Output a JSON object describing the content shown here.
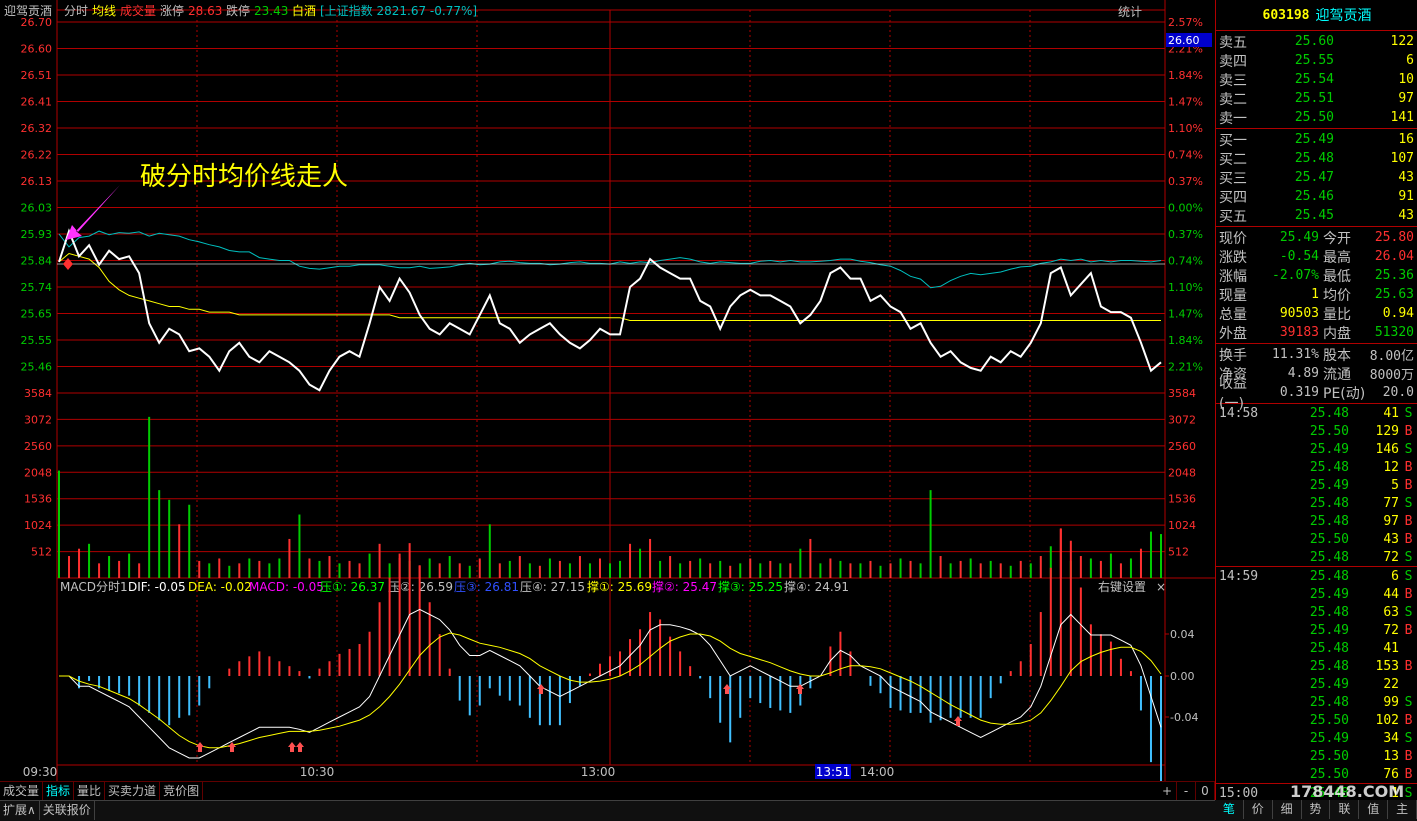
{
  "chart_header": {
    "stock_name": "迎驾贡酒",
    "mode": "分时",
    "avg_label": "均线",
    "vol_label": "成交量",
    "limit_up_label": "涨停",
    "limit_up_value": "28.63",
    "limit_down_label": "跌停",
    "limit_down_value": "23.43",
    "sector": "白酒",
    "index_info": "[上证指数 2821.67 -0.77%]",
    "stats_label": "统计"
  },
  "annotation": "破分时均价线走人",
  "price_axis": {
    "left": [
      "26.70",
      "26.60",
      "26.51",
      "26.41",
      "26.32",
      "26.22",
      "26.13",
      "26.03",
      "25.93",
      "25.84",
      "25.74",
      "25.65",
      "25.55",
      "25.46"
    ],
    "right": [
      "2.57%",
      "2.21%",
      "1.84%",
      "1.47%",
      "1.10%",
      "0.74%",
      "0.37%",
      "0.00%",
      "0.37%",
      "0.74%",
      "1.10%",
      "1.47%",
      "1.84%",
      "2.21%"
    ],
    "tag": "26.60"
  },
  "volume_axis": [
    "3584",
    "3072",
    "2560",
    "2048",
    "1536",
    "1024",
    "512"
  ],
  "macd_header": {
    "name": "MACD分时1",
    "dif": "DIF: -0.05",
    "dea": "DEA: -0.02",
    "macd": "MACD: -0.05",
    "p1": "压①: 26.37",
    "p2": "压②: 26.59",
    "p3": "压③: 26.81",
    "p4": "压④: 27.15",
    "s1": "撑①: 25.69",
    "s2": "撑②: 25.47",
    "s3": "撑③: 25.25",
    "s4": "撑④: 24.91",
    "settings": "右键设置"
  },
  "macd_axis": [
    "0.04",
    "0.00",
    "-0.04"
  ],
  "time_axis": [
    "09:30",
    "10:30",
    "13:00",
    "14:00"
  ],
  "cursor_time": "13:51",
  "bottom_tabs": [
    "成交量",
    "指标",
    "量比",
    "买卖力道",
    "竞价图"
  ],
  "bottom_bar": [
    "扩展∧",
    "关联报价"
  ],
  "panel": {
    "code": "603198",
    "name": "迎驾贡酒",
    "asks": [
      {
        "label": "卖五",
        "price": "25.60",
        "vol": "122"
      },
      {
        "label": "卖四",
        "price": "25.55",
        "vol": "6"
      },
      {
        "label": "卖三",
        "price": "25.54",
        "vol": "10"
      },
      {
        "label": "卖二",
        "price": "25.51",
        "vol": "97"
      },
      {
        "label": "卖一",
        "price": "25.50",
        "vol": "141"
      }
    ],
    "bids": [
      {
        "label": "买一",
        "price": "25.49",
        "vol": "16"
      },
      {
        "label": "买二",
        "price": "25.48",
        "vol": "107"
      },
      {
        "label": "买三",
        "price": "25.47",
        "vol": "43"
      },
      {
        "label": "买四",
        "price": "25.46",
        "vol": "91"
      },
      {
        "label": "买五",
        "price": "25.45",
        "vol": "43"
      }
    ],
    "stats1": [
      {
        "k1": "现价",
        "v1": "25.49",
        "k2": "今开",
        "v2": "25.80",
        "c1": "#00cc00",
        "c2": "#ff3030"
      },
      {
        "k1": "涨跌",
        "v1": "-0.54",
        "k2": "最高",
        "v2": "26.04",
        "c1": "#00cc00",
        "c2": "#ff3030"
      },
      {
        "k1": "涨幅",
        "v1": "-2.07%",
        "k2": "最低",
        "v2": "25.36",
        "c1": "#00cc00",
        "c2": "#00cc00"
      },
      {
        "k1": "现量",
        "v1": "1",
        "k2": "均价",
        "v2": "25.63",
        "c1": "#ffff00",
        "c2": "#00cc00"
      },
      {
        "k1": "总量",
        "v1": "90503",
        "k2": "量比",
        "v2": "0.94",
        "c1": "#ffff00",
        "c2": "#ffff00"
      },
      {
        "k1": "外盘",
        "v1": "39183",
        "k2": "内盘",
        "v2": "51320",
        "c1": "#ff3030",
        "c2": "#00cc00"
      }
    ],
    "stats2": [
      {
        "k1": "换手",
        "v1": "11.31%",
        "k2": "股本",
        "v2": "8.00亿"
      },
      {
        "k1": "净资",
        "v1": "4.89",
        "k2": "流通",
        "v2": "8000万"
      },
      {
        "k1": "收益(一)",
        "v1": "0.319",
        "k2": "PE(动)",
        "v2": "20.0"
      }
    ],
    "ticks": [
      {
        "t": "14:58",
        "p": "25.48",
        "v": "41",
        "d": "S"
      },
      {
        "t": "",
        "p": "25.50",
        "v": "129",
        "d": "B"
      },
      {
        "t": "",
        "p": "25.49",
        "v": "146",
        "d": "S"
      },
      {
        "t": "",
        "p": "25.48",
        "v": "12",
        "d": "B"
      },
      {
        "t": "",
        "p": "25.49",
        "v": "5",
        "d": "B"
      },
      {
        "t": "",
        "p": "25.48",
        "v": "77",
        "d": "S"
      },
      {
        "t": "",
        "p": "25.48",
        "v": "97",
        "d": "B"
      },
      {
        "t": "",
        "p": "25.50",
        "v": "43",
        "d": "B"
      },
      {
        "t": "",
        "p": "25.48",
        "v": "72",
        "d": "S"
      },
      {
        "t": "14:59",
        "p": "25.48",
        "v": "6",
        "d": "S"
      },
      {
        "t": "",
        "p": "25.49",
        "v": "44",
        "d": "B"
      },
      {
        "t": "",
        "p": "25.48",
        "v": "63",
        "d": "S"
      },
      {
        "t": "",
        "p": "25.49",
        "v": "72",
        "d": "B"
      },
      {
        "t": "",
        "p": "25.48",
        "v": "41",
        "d": ""
      },
      {
        "t": "",
        "p": "25.48",
        "v": "153",
        "d": "B"
      },
      {
        "t": "",
        "p": "25.49",
        "v": "22",
        "d": ""
      },
      {
        "t": "",
        "p": "25.48",
        "v": "99",
        "d": "S"
      },
      {
        "t": "",
        "p": "25.50",
        "v": "102",
        "d": "B"
      },
      {
        "t": "",
        "p": "25.49",
        "v": "34",
        "d": "S"
      },
      {
        "t": "",
        "p": "25.50",
        "v": "13",
        "d": "B"
      },
      {
        "t": "",
        "p": "25.50",
        "v": "76",
        "d": "B"
      },
      {
        "t": "15:00",
        "p": "25.48",
        "v": "1",
        "d": "S"
      }
    ],
    "tabs": [
      "笔",
      "价",
      "细",
      "势",
      "联",
      "值",
      "主"
    ]
  },
  "watermark": "178448.COM",
  "colors": {
    "up": "#ff3030",
    "down": "#00cc00",
    "grid": "#b00000",
    "price_line": "#ffffff",
    "avg_line": "#ffff00",
    "index_line": "#00bfbf"
  },
  "chart_data": {
    "type": "line",
    "price_series": [
      25.84,
      25.95,
      25.86,
      25.9,
      25.83,
      25.88,
      25.85,
      25.86,
      25.8,
      25.62,
      25.55,
      25.6,
      25.58,
      25.52,
      25.53,
      25.5,
      25.45,
      25.52,
      25.55,
      25.5,
      25.48,
      25.52,
      25.5,
      25.48,
      25.45,
      25.4,
      25.38,
      25.45,
      25.5,
      25.52,
      25.5,
      25.62,
      25.75,
      25.7,
      25.78,
      25.73,
      25.65,
      25.6,
      25.58,
      25.62,
      25.6,
      25.58,
      25.65,
      25.72,
      25.62,
      25.6,
      25.55,
      25.58,
      25.6,
      25.62,
      25.58,
      25.55,
      25.53,
      25.56,
      25.6,
      25.58,
      25.58,
      25.75,
      25.78,
      25.85,
      25.82,
      25.8,
      25.78,
      25.78,
      25.7,
      25.68,
      25.6,
      25.68,
      25.72,
      25.74,
      25.72,
      25.72,
      25.7,
      25.68,
      25.62,
      25.65,
      25.7,
      25.8,
      25.82,
      25.78,
      25.78,
      25.7,
      25.72,
      25.68,
      25.66,
      25.6,
      25.62,
      25.55,
      25.5,
      25.52,
      25.48,
      25.46,
      25.45,
      25.5,
      25.48,
      25.52,
      25.5,
      25.55,
      25.62,
      25.8,
      25.82,
      25.72,
      25.76,
      25.8,
      25.68,
      25.66,
      25.66,
      25.64,
      25.55,
      25.45,
      25.48
    ],
    "avg_series": [
      25.84,
      25.87,
      25.86,
      25.85,
      25.82,
      25.77,
      25.74,
      25.72,
      25.71,
      25.7,
      25.69,
      25.68,
      25.68,
      25.67,
      25.67,
      25.66,
      25.66,
      25.66,
      25.65,
      25.65,
      25.65,
      25.65,
      25.65,
      25.65,
      25.65,
      25.65,
      25.65,
      25.65,
      25.65,
      25.65,
      25.65,
      25.65,
      25.65,
      25.65,
      25.64,
      25.64,
      25.64,
      25.64,
      25.64,
      25.64,
      25.64,
      25.64,
      25.64,
      25.64,
      25.64,
      25.64,
      25.64,
      25.64,
      25.64,
      25.64,
      25.64,
      25.64,
      25.64,
      25.64,
      25.64,
      25.64,
      25.64,
      25.63,
      25.63,
      25.63,
      25.63,
      25.63,
      25.63,
      25.63,
      25.63,
      25.63,
      25.63,
      25.63,
      25.63,
      25.63,
      25.63,
      25.63,
      25.63,
      25.63,
      25.63,
      25.63,
      25.63,
      25.63,
      25.63,
      25.63,
      25.63,
      25.63,
      25.63,
      25.63,
      25.63,
      25.63,
      25.63,
      25.63,
      25.63,
      25.63,
      25.63,
      25.63,
      25.63,
      25.63,
      25.63,
      25.63,
      25.63,
      25.63,
      25.63,
      25.63,
      25.63,
      25.63,
      25.63,
      25.63,
      25.63,
      25.63,
      25.63,
      25.63,
      25.63,
      25.63,
      25.63
    ],
    "index_series_pct": [
      0.37,
      0.55,
      0.42,
      0.4,
      0.33,
      0.38,
      0.35,
      0.36,
      0.34,
      0.4,
      0.36,
      0.38,
      0.4,
      0.45,
      0.48,
      0.52,
      0.55,
      0.6,
      0.62,
      0.62,
      0.7,
      0.72,
      0.74,
      0.74,
      0.82,
      0.85,
      0.86,
      0.84,
      0.82,
      0.82,
      0.8,
      0.8,
      0.8,
      0.82,
      0.84,
      0.84,
      0.82,
      0.85,
      0.84,
      0.83,
      0.8,
      0.78,
      0.8,
      0.79,
      0.76,
      0.75,
      0.77,
      0.78,
      0.78,
      0.8,
      0.79,
      0.77,
      0.76,
      0.78,
      0.78,
      0.79,
      0.76,
      0.78,
      0.76,
      0.77,
      0.74,
      0.72,
      0.7,
      0.72,
      0.76,
      0.78,
      0.76,
      0.77,
      0.78,
      0.78,
      0.75,
      0.74,
      0.76,
      0.74,
      0.76,
      0.76,
      0.75,
      0.74,
      0.72,
      0.72,
      0.75,
      0.77,
      0.8,
      0.82,
      0.88,
      0.96,
      1.0,
      1.12,
      1.1,
      1.02,
      0.96,
      0.92,
      0.94,
      0.92,
      0.9,
      0.86,
      0.83,
      0.82,
      0.78,
      0.76,
      0.72,
      0.74,
      0.72,
      0.76,
      0.74,
      0.76,
      0.74,
      0.74,
      0.75,
      0.76,
      0.74
    ],
    "volume": [
      2200,
      450,
      600,
      700,
      300,
      450,
      350,
      500,
      300,
      3300,
      1800,
      1600,
      1100,
      1500,
      350,
      300,
      400,
      250,
      300,
      400,
      350,
      300,
      400,
      800,
      1300,
      400,
      350,
      450,
      300,
      350,
      300,
      500,
      700,
      300,
      500,
      350,
      250,
      400,
      300,
      450,
      300,
      250,
      400,
      1100,
      300,
      350,
      450,
      300,
      250,
      400,
      350,
      300,
      450,
      300,
      400,
      300,
      350,
      700,
      600,
      800,
      350,
      450,
      300,
      350,
      400,
      300,
      350,
      250,
      300,
      400,
      300,
      350,
      300,
      300,
      600,
      800,
      300,
      400,
      350,
      300,
      300,
      350,
      250,
      300,
      400,
      350,
      300,
      1800,
      450,
      300,
      350,
      400,
      300,
      350,
      300,
      250,
      350,
      300,
      450,
      650,
      1000,
      350,
      450,
      400,
      350,
      500,
      300,
      400,
      600,
      950,
      900
    ],
    "volume_up": [
      false,
      true,
      true,
      false,
      true,
      false,
      true,
      false,
      true,
      false,
      false,
      false,
      true,
      false,
      true,
      false,
      true,
      false,
      true,
      false,
      true,
      false,
      false,
      true,
      false,
      true,
      false,
      true,
      false,
      true,
      true,
      false,
      true,
      false,
      true,
      false,
      true,
      false,
      true,
      false,
      true,
      false,
      true,
      false,
      true,
      false,
      true,
      false,
      true,
      false,
      true,
      false,
      true,
      false,
      true,
      false,
      false,
      true,
      false,
      true,
      false,
      true,
      false,
      true,
      false,
      true,
      false,
      true,
      false,
      true,
      false,
      true,
      false,
      true,
      false,
      true,
      false,
      true,
      false,
      true,
      false,
      true,
      false,
      true,
      false,
      true,
      false,
      false,
      true,
      false,
      true,
      false,
      true,
      false,
      true,
      false,
      true,
      false,
      true,
      false,
      true,
      false,
      true,
      false,
      true,
      false,
      true,
      false,
      true,
      false,
      false
    ],
    "macd_dif": [
      0.0,
      0.0,
      -0.01,
      -0.01,
      -0.015,
      -0.02,
      -0.025,
      -0.03,
      -0.04,
      -0.05,
      -0.06,
      -0.07,
      -0.075,
      -0.08,
      -0.08,
      -0.075,
      -0.07,
      -0.065,
      -0.06,
      -0.055,
      -0.05,
      -0.05,
      -0.05,
      -0.05,
      -0.052,
      -0.055,
      -0.05,
      -0.045,
      -0.04,
      -0.035,
      -0.03,
      -0.02,
      0.0,
      0.02,
      0.04,
      0.06,
      0.065,
      0.06,
      0.055,
      0.045,
      0.03,
      0.02,
      0.02,
      0.025,
      0.02,
      0.015,
      0.01,
      0.0,
      -0.01,
      -0.015,
      -0.02,
      -0.015,
      -0.01,
      -0.005,
      0.0,
      0.005,
      0.01,
      0.02,
      0.03,
      0.045,
      0.05,
      0.05,
      0.048,
      0.045,
      0.04,
      0.03,
      0.015,
      0.0,
      0.005,
      0.01,
      0.005,
      0.0,
      -0.005,
      -0.01,
      -0.01,
      -0.005,
      0.0,
      0.015,
      0.025,
      0.02,
      0.01,
      0.005,
      0.0,
      -0.01,
      -0.015,
      -0.02,
      -0.025,
      -0.035,
      -0.04,
      -0.045,
      -0.05,
      -0.055,
      -0.06,
      -0.055,
      -0.05,
      -0.045,
      -0.04,
      -0.03,
      -0.01,
      0.02,
      0.05,
      0.06,
      0.05,
      0.04,
      0.04,
      0.04,
      0.035,
      0.03,
      0.01,
      -0.02,
      -0.05
    ],
    "macd_dea": [
      0.0,
      0.0,
      -0.005,
      -0.008,
      -0.01,
      -0.014,
      -0.018,
      -0.022,
      -0.028,
      -0.035,
      -0.042,
      -0.05,
      -0.058,
      -0.064,
      -0.068,
      -0.07,
      -0.07,
      -0.068,
      -0.066,
      -0.063,
      -0.06,
      -0.058,
      -0.056,
      -0.054,
      -0.054,
      -0.054,
      -0.053,
      -0.051,
      -0.049,
      -0.046,
      -0.043,
      -0.038,
      -0.03,
      -0.02,
      -0.008,
      0.006,
      0.02,
      0.03,
      0.038,
      0.042,
      0.04,
      0.036,
      0.032,
      0.03,
      0.028,
      0.025,
      0.022,
      0.017,
      0.01,
      0.005,
      0.0,
      -0.004,
      -0.006,
      -0.006,
      -0.005,
      -0.003,
      0.0,
      0.005,
      0.011,
      0.019,
      0.027,
      0.034,
      0.038,
      0.041,
      0.041,
      0.039,
      0.034,
      0.027,
      0.022,
      0.019,
      0.016,
      0.013,
      0.009,
      0.005,
      0.002,
      0.0,
      0.0,
      0.003,
      0.007,
      0.01,
      0.01,
      0.009,
      0.007,
      0.003,
      -0.001,
      -0.005,
      -0.01,
      -0.016,
      -0.022,
      -0.028,
      -0.033,
      -0.038,
      -0.043,
      -0.046,
      -0.047,
      -0.047,
      -0.046,
      -0.043,
      -0.036,
      -0.024,
      -0.01,
      0.005,
      0.014,
      0.019,
      0.023,
      0.026,
      0.028,
      0.028,
      0.024,
      0.015,
      0.002
    ]
  }
}
